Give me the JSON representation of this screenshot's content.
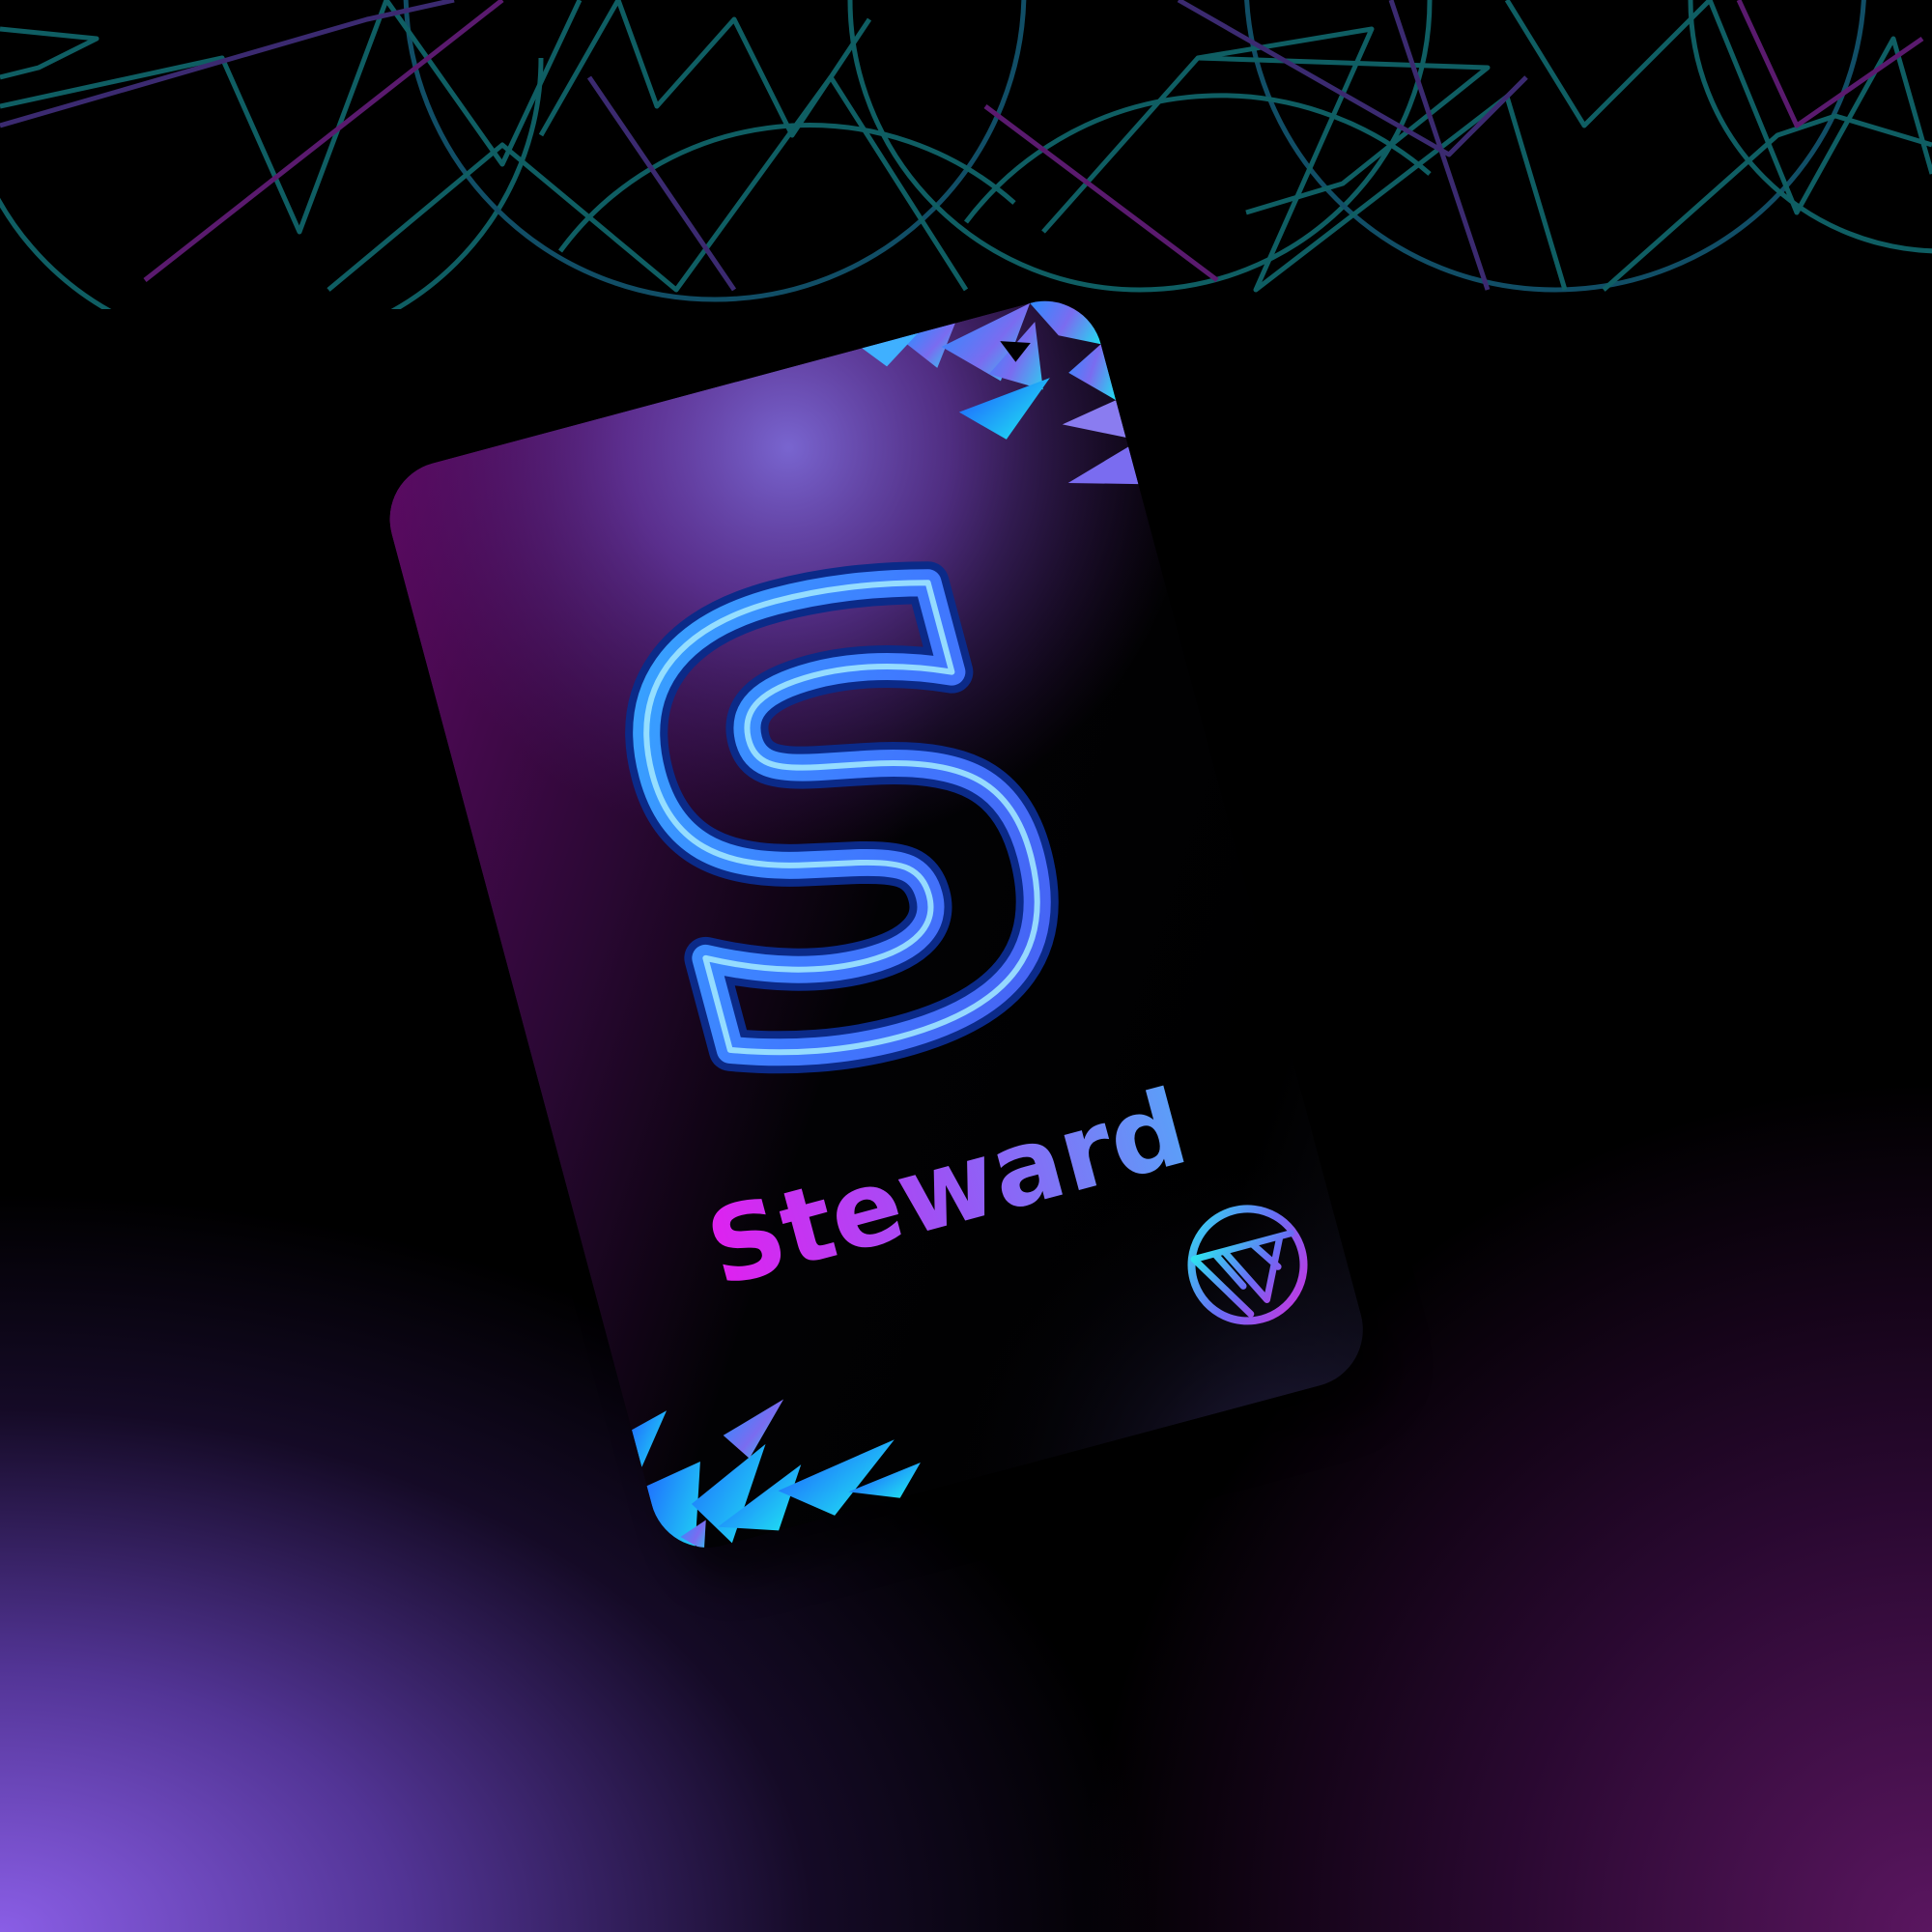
{
  "card": {
    "title": "Steward",
    "monogram_letter": "S",
    "emblem_icon": "circle-triangle-emblem-icon"
  },
  "colors": {
    "background_black": "#000000",
    "background_violet": "#8a5ee6",
    "background_plum": "#5a1660",
    "pattern_teal": "#0f5e63",
    "pattern_purple": "#5a1a6e",
    "title_magenta": "#e020f0",
    "title_blue": "#5aa0f8",
    "letter_blue": "#3d8cff",
    "shard_cyan": "#1fe0f0"
  }
}
